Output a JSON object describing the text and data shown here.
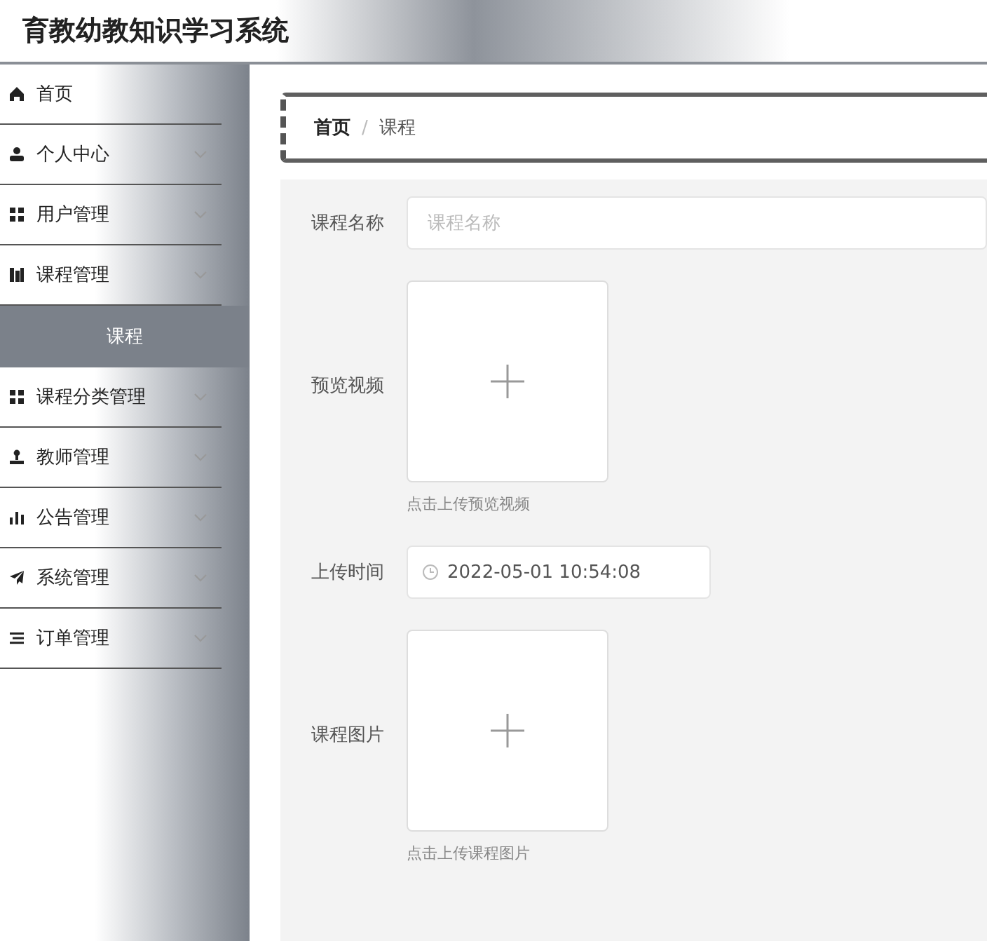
{
  "header": {
    "title": "育教幼教知识学习系统"
  },
  "sidebar": {
    "items": [
      {
        "kind": "link",
        "label": "首页"
      },
      {
        "kind": "submenu",
        "label": "个人中心"
      },
      {
        "kind": "submenu",
        "label": "用户管理"
      },
      {
        "kind": "submenu",
        "label": "课程管理",
        "children": [
          {
            "label": "课程",
            "selected": true
          }
        ]
      },
      {
        "kind": "submenu",
        "label": "课程分类管理"
      },
      {
        "kind": "submenu",
        "label": "教师管理"
      },
      {
        "kind": "submenu",
        "label": "公告管理"
      },
      {
        "kind": "submenu",
        "label": "系统管理"
      },
      {
        "kind": "submenu",
        "label": "订单管理"
      }
    ]
  },
  "breadcrumb": {
    "items": [
      "首页",
      "课程"
    ],
    "separator": "/"
  },
  "form": {
    "fields": [
      {
        "kind": "text",
        "label": "课程名称",
        "placeholder": "课程名称"
      },
      {
        "kind": "upload",
        "label": "预览视频",
        "hint": "点击上传预览视频"
      },
      {
        "kind": "datetime",
        "label": "上传时间",
        "value": "2022-05-01 10:54:08"
      },
      {
        "kind": "upload",
        "label": "课程图片",
        "hint": "点击上传课程图片"
      }
    ]
  }
}
